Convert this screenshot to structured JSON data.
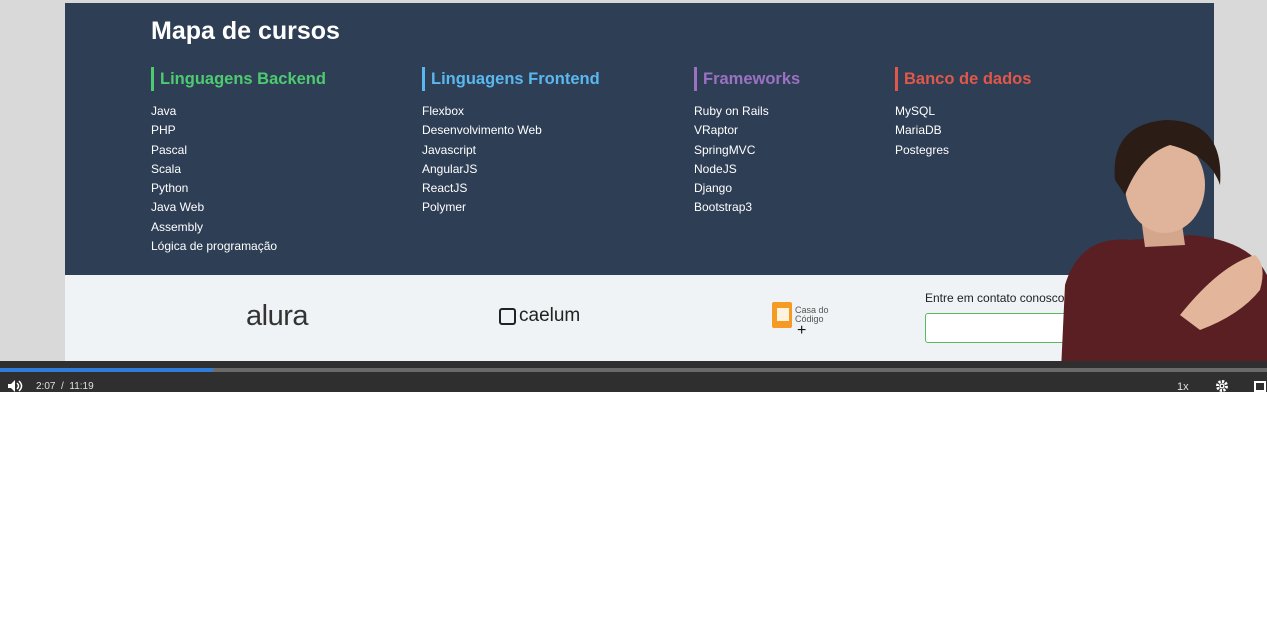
{
  "course_map": {
    "title": "Mapa de cursos",
    "columns": [
      {
        "heading": "Linguagens Backend",
        "color": "#4ecb71",
        "items": [
          "Java",
          "PHP",
          "Pascal",
          "Scala",
          "Python",
          "Java Web",
          "Assembly",
          "Lógica de programação"
        ]
      },
      {
        "heading": "Linguagens Frontend",
        "color": "#5ab8ee",
        "items": [
          "Flexbox",
          "Desenvolvimento Web",
          "Javascript",
          "AngularJS",
          "ReactJS",
          "Polymer"
        ]
      },
      {
        "heading": "Frameworks",
        "color": "#9b72c2",
        "items": [
          "Ruby on Rails",
          "VRaptor",
          "SpringMVC",
          "NodeJS",
          "Django",
          "Bootstrap3"
        ]
      },
      {
        "heading": "Banco de dados",
        "color": "#e0584a",
        "items": [
          "MySQL",
          "MariaDB",
          "Postegres"
        ]
      }
    ]
  },
  "partners": {
    "alura": "alura",
    "caelum": "caelum",
    "casa_do_codigo": [
      "Casa do",
      "Código"
    ]
  },
  "contact": {
    "label": "Entre em contato conosco",
    "input_value": ""
  },
  "player": {
    "current_time": "2:07",
    "separator": "/",
    "duration": "11:19",
    "progress": 0.168,
    "speed": "1x"
  },
  "icons": {
    "volume": "volume-icon",
    "settings": "gear-icon",
    "fullscreen": "fullscreen-icon",
    "cursor": "crosshair-cursor-icon"
  }
}
